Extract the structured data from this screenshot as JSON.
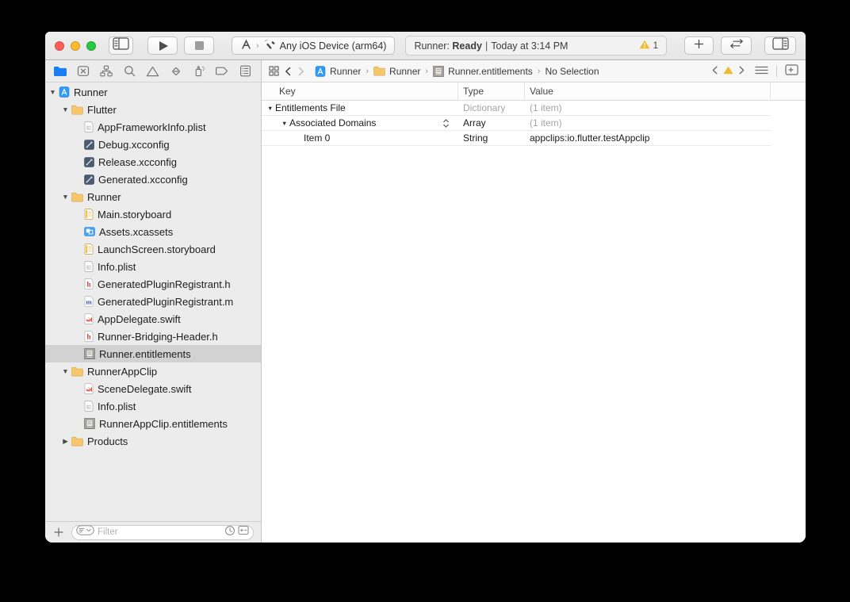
{
  "colors": {
    "accent_blue": "#1b7ef3",
    "folder_yellow": "#f6c66d",
    "warning_yellow": "#f0ba2e",
    "selection_gray": "#d2d2d2",
    "swift_orange": "#f05138"
  },
  "toolbar": {
    "scheme_label": "Any iOS Device (arm64)",
    "status": {
      "app": "Runner:",
      "state": "Ready",
      "separator": "|",
      "time": "Today at 3:14 PM",
      "warning_count": "1"
    }
  },
  "navigator": {
    "icons": [
      {
        "name": "project-navigator",
        "selected": true
      },
      {
        "name": "source-control-navigator"
      },
      {
        "name": "symbol-navigator"
      },
      {
        "name": "find-navigator"
      },
      {
        "name": "issue-navigator"
      },
      {
        "name": "test-navigator"
      },
      {
        "name": "debug-navigator"
      },
      {
        "name": "breakpoint-navigator"
      },
      {
        "name": "report-navigator"
      }
    ],
    "tree": [
      {
        "label": "Runner",
        "icon": "project",
        "level": 0,
        "disclosure": "open"
      },
      {
        "label": "Flutter",
        "icon": "folder",
        "level": 1,
        "disclosure": "open"
      },
      {
        "label": "AppFrameworkInfo.plist",
        "icon": "plist",
        "level": 2
      },
      {
        "label": "Debug.xcconfig",
        "icon": "xcconfig",
        "level": 2
      },
      {
        "label": "Release.xcconfig",
        "icon": "xcconfig",
        "level": 2
      },
      {
        "label": "Generated.xcconfig",
        "icon": "xcconfig",
        "level": 2
      },
      {
        "label": "Runner",
        "icon": "folder",
        "level": 1,
        "disclosure": "open"
      },
      {
        "label": "Main.storyboard",
        "icon": "storyboard",
        "level": 2
      },
      {
        "label": "Assets.xcassets",
        "icon": "xcassets",
        "level": 2
      },
      {
        "label": "LaunchScreen.storyboard",
        "icon": "storyboard",
        "level": 2
      },
      {
        "label": "Info.plist",
        "icon": "plist",
        "level": 2
      },
      {
        "label": "GeneratedPluginRegistrant.h",
        "icon": "hfile",
        "level": 2
      },
      {
        "label": "GeneratedPluginRegistrant.m",
        "icon": "mfile",
        "level": 2
      },
      {
        "label": "AppDelegate.swift",
        "icon": "swift",
        "level": 2
      },
      {
        "label": "Runner-Bridging-Header.h",
        "icon": "hfile",
        "level": 2
      },
      {
        "label": "Runner.entitlements",
        "icon": "entitlements",
        "level": 2,
        "selected": true
      },
      {
        "label": "RunnerAppClip",
        "icon": "folder",
        "level": 1,
        "disclosure": "open"
      },
      {
        "label": "SceneDelegate.swift",
        "icon": "swift",
        "level": 2
      },
      {
        "label": "Info.plist",
        "icon": "plist",
        "level": 2
      },
      {
        "label": "RunnerAppClip.entitlements",
        "icon": "entitlements",
        "level": 2
      },
      {
        "label": "Products",
        "icon": "folder",
        "level": 1,
        "disclosure": "closed"
      }
    ],
    "filter_placeholder": "Filter"
  },
  "jumpbar": {
    "crumbs": [
      {
        "icon": "project",
        "label": "Runner"
      },
      {
        "icon": "folder",
        "label": "Runner"
      },
      {
        "icon": "entitlements",
        "label": "Runner.entitlements"
      },
      {
        "label": "No Selection"
      }
    ]
  },
  "editor": {
    "columns": [
      "Key",
      "Type",
      "Value"
    ],
    "rows": [
      {
        "key": "Entitlements File",
        "type": "Dictionary",
        "value": "(1 item)",
        "level": 0,
        "disclosure": "open",
        "type_muted": true,
        "value_muted": true
      },
      {
        "key": "Associated Domains",
        "type": "Array",
        "value": "(1 item)",
        "level": 1,
        "disclosure": "open",
        "stepper": true,
        "value_muted": true
      },
      {
        "key": "Item 0",
        "type": "String",
        "value": "appclips:io.flutter.testAppclip",
        "level": 2
      }
    ]
  }
}
